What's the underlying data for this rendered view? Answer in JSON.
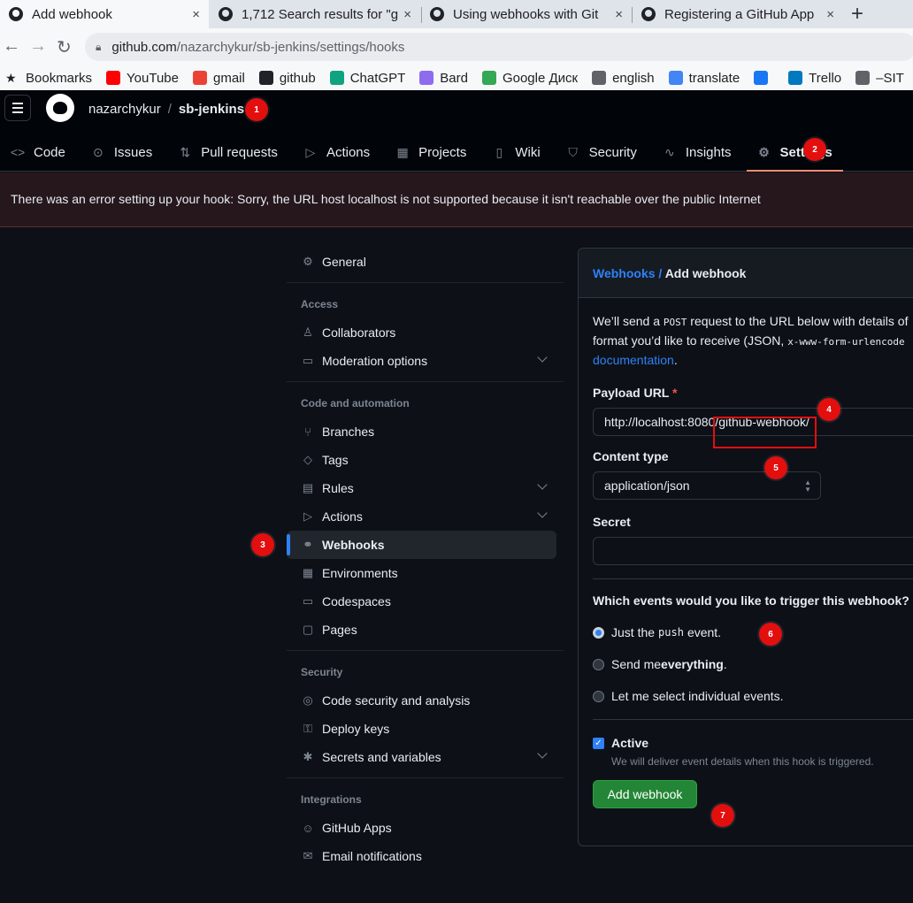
{
  "browser": {
    "tabs": [
      {
        "title": "Add webhook",
        "close": "×"
      },
      {
        "title": "1,712 Search results for \"g",
        "close": "×"
      },
      {
        "title": "Using webhooks with Git",
        "close": "×"
      },
      {
        "title": "Registering a GitHub App",
        "close": "×"
      }
    ],
    "new_tab": "+",
    "url_host": "github.com",
    "url_path": "/nazarchykur/sb-jenkins/settings/hooks",
    "bookmarks": [
      {
        "label": "Bookmarks",
        "color": "#202124",
        "icon": "star-icon"
      },
      {
        "label": "YouTube",
        "color": "#ff0000",
        "icon": "youtube-icon"
      },
      {
        "label": "gmail",
        "color": "#ea4335",
        "icon": "gmail-icon"
      },
      {
        "label": "github",
        "color": "#1f2328",
        "icon": "github-icon"
      },
      {
        "label": "ChatGPT",
        "color": "#10a37f",
        "icon": "chatgpt-icon"
      },
      {
        "label": "Bard",
        "color": "#8e6cef",
        "icon": "bard-icon"
      },
      {
        "label": "Google Диск",
        "color": "#34a853",
        "icon": "drive-icon"
      },
      {
        "label": "english",
        "color": "#5f6368",
        "icon": "folder-icon"
      },
      {
        "label": "translate",
        "color": "#4285f4",
        "icon": "translate-icon"
      },
      {
        "label": "",
        "color": "#1877f2",
        "icon": "facebook-icon"
      },
      {
        "label": "Trello",
        "color": "#0079bf",
        "icon": "trello-icon"
      },
      {
        "label": "–SIT",
        "color": "#5f6368",
        "icon": "folder-icon"
      }
    ]
  },
  "header": {
    "owner": "nazarchykur",
    "sep": "/",
    "repo": "sb-jenkins"
  },
  "reponav": [
    {
      "label": "Code",
      "icon": "<>"
    },
    {
      "label": "Issues",
      "icon": "⊙"
    },
    {
      "label": "Pull requests",
      "icon": "⇅"
    },
    {
      "label": "Actions",
      "icon": "▷"
    },
    {
      "label": "Projects",
      "icon": "▦"
    },
    {
      "label": "Wiki",
      "icon": "▯"
    },
    {
      "label": "Security",
      "icon": "⛉"
    },
    {
      "label": "Insights",
      "icon": "∿"
    },
    {
      "label": "Settings",
      "icon": "⚙"
    }
  ],
  "error": "There was an error setting up your hook: Sorry, the URL host localhost is not supported because it isn't reachable over the public Internet",
  "sidebar": {
    "general": "General",
    "access_heading": "Access",
    "access": [
      {
        "label": "Collaborators",
        "icon": "♙",
        "chev": false
      },
      {
        "label": "Moderation options",
        "icon": "▭",
        "chev": true
      }
    ],
    "code_heading": "Code and automation",
    "code": [
      {
        "label": "Branches",
        "icon": "⑂",
        "chev": false
      },
      {
        "label": "Tags",
        "icon": "◇",
        "chev": false
      },
      {
        "label": "Rules",
        "icon": "▤",
        "chev": true
      },
      {
        "label": "Actions",
        "icon": "▷",
        "chev": true
      },
      {
        "label": "Webhooks",
        "icon": "⚭",
        "chev": false
      },
      {
        "label": "Environments",
        "icon": "▦",
        "chev": false
      },
      {
        "label": "Codespaces",
        "icon": "▭",
        "chev": false
      },
      {
        "label": "Pages",
        "icon": "▢",
        "chev": false
      }
    ],
    "security_heading": "Security",
    "security": [
      {
        "label": "Code security and analysis",
        "icon": "◎",
        "chev": false
      },
      {
        "label": "Deploy keys",
        "icon": "⚿",
        "chev": false
      },
      {
        "label": "Secrets and variables",
        "icon": "✱",
        "chev": true
      }
    ],
    "integrations_heading": "Integrations",
    "integrations": [
      {
        "label": "GitHub Apps",
        "icon": "☺",
        "chev": false
      },
      {
        "label": "Email notifications",
        "icon": "✉",
        "chev": false
      }
    ]
  },
  "form": {
    "breadcrumb_link": "Webhooks",
    "breadcrumb_sep": " / ",
    "breadcrumb_current": "Add webhook",
    "desc_1": "We’ll send a ",
    "desc_code_1": "POST",
    "desc_2": " request to the URL below with details of",
    "desc_3": "format you’d like to receive (JSON, ",
    "desc_code_2": "x-www-form-urlencode",
    "desc_link": "documentation",
    "desc_end": ".",
    "payload_label": "Payload URL",
    "required_mark": "*",
    "payload_value": "http://localhost:8080/github-webhook/",
    "content_type_label": "Content type",
    "content_type_value": "application/json",
    "secret_label": "Secret",
    "secret_value": "",
    "events_question": "Which events would you like to trigger this webhook?",
    "event_push_pre": "Just the",
    "event_push_code": "push",
    "event_push_post": "event.",
    "event_all_pre": "Send me ",
    "event_all_bold": "everything",
    "event_all_post": ".",
    "event_select": "Let me select individual events.",
    "active_label": "Active",
    "active_note": "We will deliver event details when this hook is triggered.",
    "submit": "Add webhook"
  },
  "annotations": [
    "1",
    "2",
    "3",
    "4",
    "5",
    "6",
    "7"
  ],
  "colors": {
    "accent": "#2f81f7",
    "danger": "#e30e0e",
    "success": "#238636",
    "nav_underline": "#fd8c73"
  }
}
